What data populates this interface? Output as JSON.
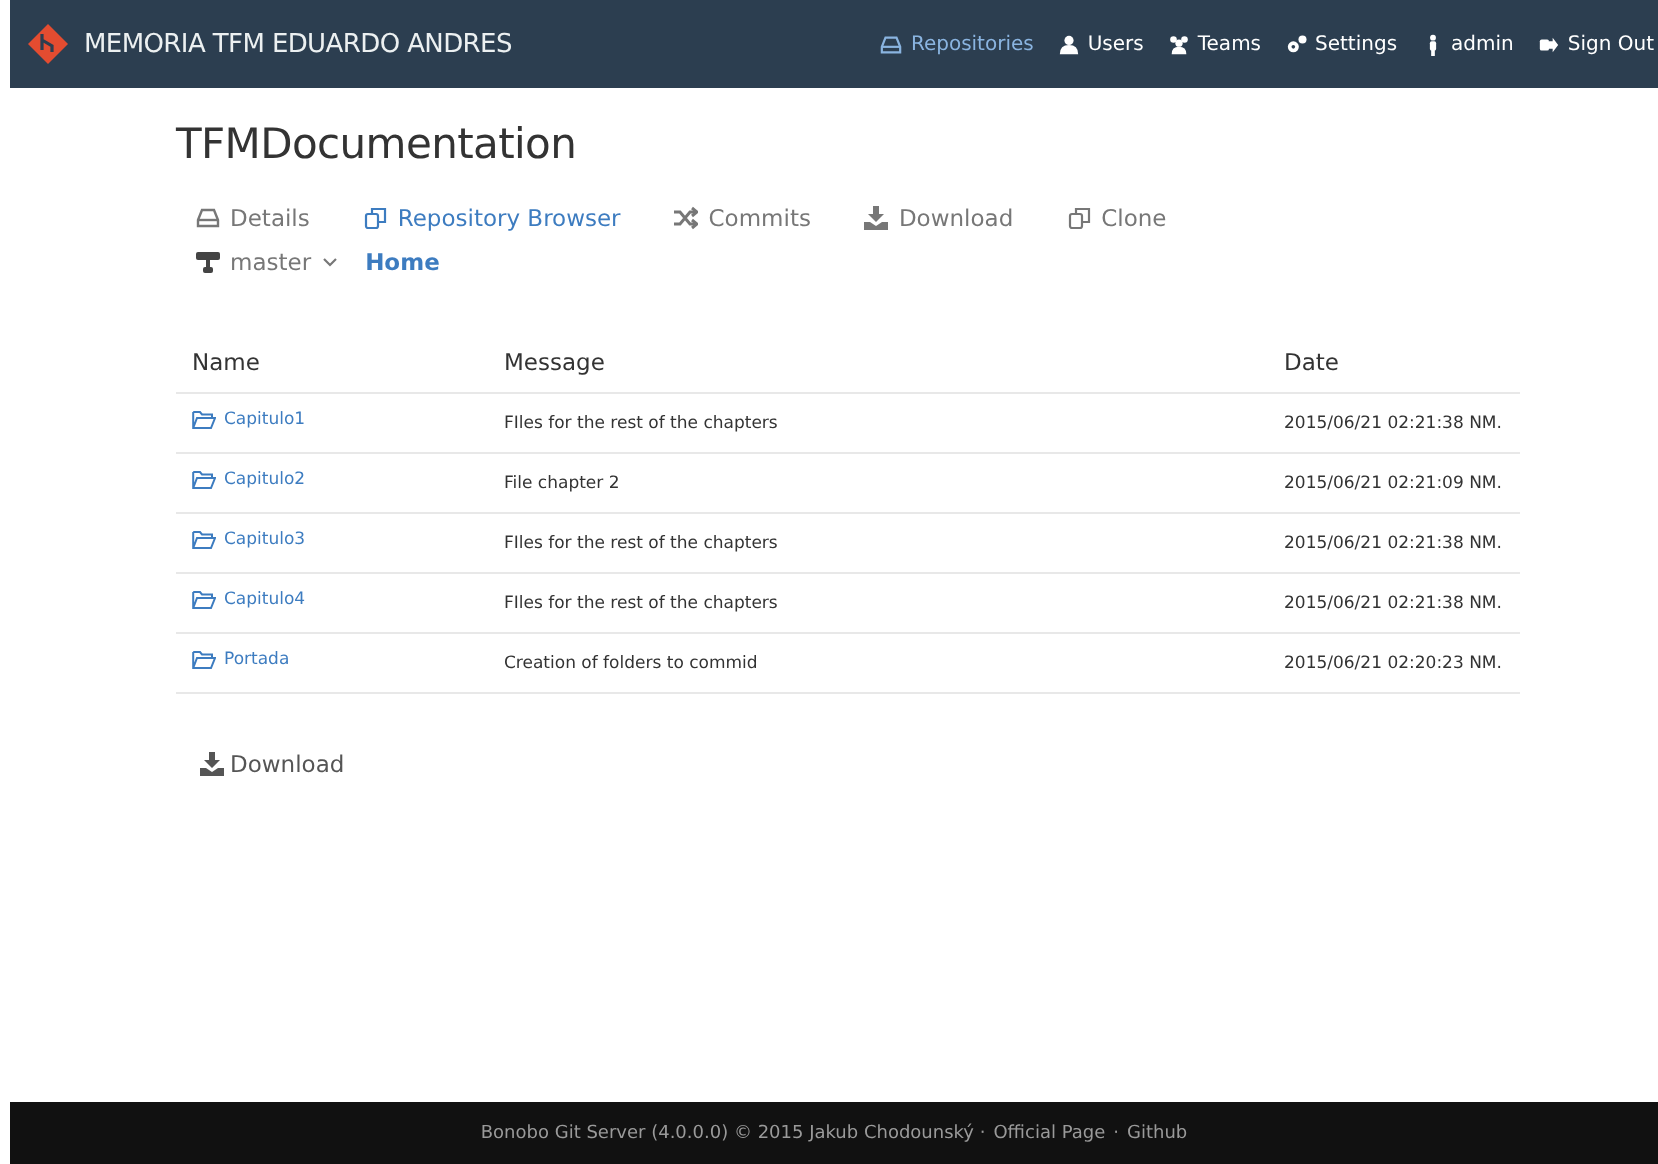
{
  "brand": {
    "title": "MEMORIA TFM EDUARDO ANDRES"
  },
  "nav": [
    {
      "label": "Repositories",
      "selected": true
    },
    {
      "label": "Users",
      "selected": false
    },
    {
      "label": "Teams",
      "selected": false
    },
    {
      "label": "Settings",
      "selected": false
    },
    {
      "label": "admin",
      "selected": false
    },
    {
      "label": "Sign Out",
      "selected": false
    }
  ],
  "repository": {
    "title": "TFMDocumentation"
  },
  "tabs": [
    {
      "label": "Details",
      "selected": false
    },
    {
      "label": "Repository Browser",
      "selected": true
    },
    {
      "label": "Commits",
      "selected": false
    },
    {
      "label": "Download",
      "selected": false
    },
    {
      "label": "Clone",
      "selected": false
    }
  ],
  "branch": {
    "label": "master"
  },
  "breadcrumb": [
    "Home"
  ],
  "table": {
    "columns": [
      "Name",
      "Message",
      "Date"
    ],
    "rows": [
      {
        "name": "Capitulo1",
        "message": "FIles for the rest of the chapters",
        "date": "2015/06/21 02:21:38 NM."
      },
      {
        "name": "Capitulo2",
        "message": "File chapter 2",
        "date": "2015/06/21 02:21:09 NM."
      },
      {
        "name": "Capitulo3",
        "message": "FIles for the rest of the chapters",
        "date": "2015/06/21 02:21:38 NM."
      },
      {
        "name": "Capitulo4",
        "message": "FIles for the rest of the chapters",
        "date": "2015/06/21 02:21:38 NM."
      },
      {
        "name": "Portada",
        "message": "Creation of folders to commid",
        "date": "2015/06/21 02:20:23 NM."
      }
    ]
  },
  "download": {
    "label": "Download"
  },
  "footer": {
    "text": "Bonobo Git Server (4.0.0.0) © 2015 Jakub Chodounský ·",
    "links": [
      "Official Page",
      "Github"
    ],
    "separator": "·"
  }
}
